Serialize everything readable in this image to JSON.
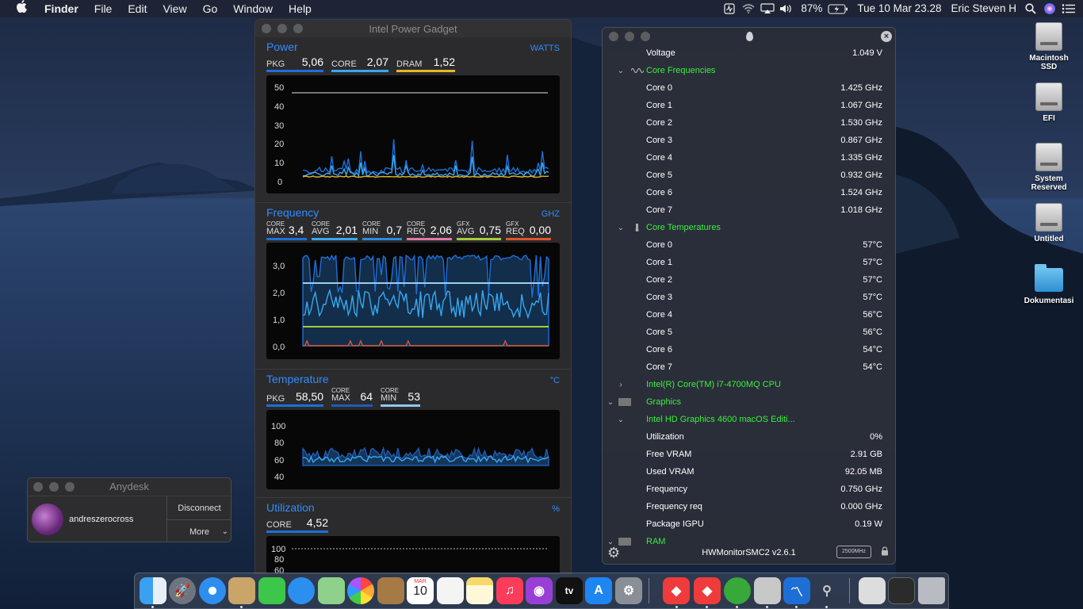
{
  "menubar": {
    "apple": "",
    "app_name": "Finder",
    "menus": [
      "File",
      "Edit",
      "View",
      "Go",
      "Window",
      "Help"
    ],
    "battery_percent": "87%",
    "datetime": "Tue 10 Mar  23.28",
    "user": "Eric Steven H"
  },
  "desktop_icons": {
    "macintosh_ssd": "Macintosh SSD",
    "efi": "EFI",
    "system_reserved": "System Reserved",
    "untitled": "Untitled",
    "dokumentasi": "Dokumentasi"
  },
  "ipg": {
    "title": "Intel Power Gadget",
    "power": {
      "title": "Power",
      "unit": "WATTS",
      "pkg_label": "PKG",
      "pkg_value": "5,06",
      "core_label": "CORE",
      "core_value": "2,07",
      "dram_label": "DRAM",
      "dram_value": "1,52",
      "y_ticks": [
        "50",
        "40",
        "30",
        "20",
        "10",
        "0"
      ]
    },
    "frequency": {
      "title": "Frequency",
      "unit": "GHZ",
      "m1_top": "CORE",
      "m1_bot": "MAX",
      "m1_val": "3,4",
      "m2_top": "CORE",
      "m2_bot": "AVG",
      "m2_val": "2,01",
      "m3_top": "CORE",
      "m3_bot": "MIN",
      "m3_val": "0,7",
      "m4_top": "CORE",
      "m4_bot": "REQ",
      "m4_val": "2,06",
      "m5_top": "GFX",
      "m5_bot": "AVG",
      "m5_val": "0,75",
      "m6_top": "GFX",
      "m6_bot": "REQ",
      "m6_val": "0,00",
      "y_ticks": [
        "3,0",
        "2,0",
        "1,0",
        "0,0"
      ]
    },
    "temperature": {
      "title": "Temperature",
      "unit": "°C",
      "pkg_label": "PKG",
      "pkg_value": "58,50",
      "m2_top": "CORE",
      "m2_bot": "MAX",
      "m2_val": "64",
      "m3_top": "CORE",
      "m3_bot": "MIN",
      "m3_val": "53",
      "y_ticks": [
        "100",
        "80",
        "60",
        "40"
      ]
    },
    "utilization": {
      "title": "Utilization",
      "unit": "%",
      "core_label": "CORE",
      "core_value": "4,52",
      "y_ticks": [
        "100",
        "80",
        "60"
      ]
    }
  },
  "hwm": {
    "rows": [
      {
        "type": "item",
        "name": "Voltage",
        "value": "1.049 V"
      },
      {
        "type": "group",
        "name": "Core Frequencies",
        "chev": "⌄",
        "icon": "wave"
      },
      {
        "type": "item",
        "name": "Core 0",
        "value": "1.425 GHz"
      },
      {
        "type": "item",
        "name": "Core 1",
        "value": "1.067 GHz"
      },
      {
        "type": "item",
        "name": "Core 2",
        "value": "1.530 GHz"
      },
      {
        "type": "item",
        "name": "Core 3",
        "value": "0.867 GHz"
      },
      {
        "type": "item",
        "name": "Core 4",
        "value": "1.335 GHz"
      },
      {
        "type": "item",
        "name": "Core 5",
        "value": "0.932 GHz"
      },
      {
        "type": "item",
        "name": "Core 6",
        "value": "1.524 GHz"
      },
      {
        "type": "item",
        "name": "Core 7",
        "value": "1.018 GHz"
      },
      {
        "type": "group",
        "name": "Core Temperatures",
        "chev": "⌄",
        "icon": "thermo"
      },
      {
        "type": "item",
        "name": "Core 0",
        "value": "57°C"
      },
      {
        "type": "item",
        "name": "Core 1",
        "value": "57°C"
      },
      {
        "type": "item",
        "name": "Core 2",
        "value": "57°C"
      },
      {
        "type": "item",
        "name": "Core 3",
        "value": "57°C"
      },
      {
        "type": "item",
        "name": "Core 4",
        "value": "56°C"
      },
      {
        "type": "item",
        "name": "Core 5",
        "value": "56°C"
      },
      {
        "type": "item",
        "name": "Core 6",
        "value": "54°C"
      },
      {
        "type": "item",
        "name": "Core 7",
        "value": "54°C"
      },
      {
        "type": "group",
        "name": "Intel(R) Core(TM) i7-4700MQ CPU",
        "chev": "›",
        "icon": ""
      },
      {
        "type": "group",
        "name": "Graphics",
        "chev": "⌄",
        "icon": "gpu",
        "level": 0
      },
      {
        "type": "group",
        "name": "Intel HD Graphics 4600 macOS Editi...",
        "chev": "⌄",
        "icon": ""
      },
      {
        "type": "item",
        "name": "Utilization",
        "value": "0%"
      },
      {
        "type": "item",
        "name": "Free VRAM",
        "value": "2.91 GB"
      },
      {
        "type": "item",
        "name": "Used VRAM",
        "value": "92.05 MB"
      },
      {
        "type": "item",
        "name": "Frequency",
        "value": "0.750 GHz"
      },
      {
        "type": "item",
        "name": "Frequency req",
        "value": "0.000 GHz"
      },
      {
        "type": "item",
        "name": "Package IGPU",
        "value": "0.19 W"
      },
      {
        "type": "group",
        "name": "RAM",
        "chev": "⌄",
        "icon": "ram",
        "level": 0
      }
    ],
    "version": "HWMonitorSMC2 v2.6.1",
    "chip_label": "2500MHz"
  },
  "anydesk": {
    "title": "Anydesk",
    "user": "andreszerocross",
    "disconnect": "Disconnect",
    "more": "More"
  },
  "dock": {
    "calendar_month": "MAR",
    "calendar_day": "10",
    "tv_label": "tv"
  }
}
